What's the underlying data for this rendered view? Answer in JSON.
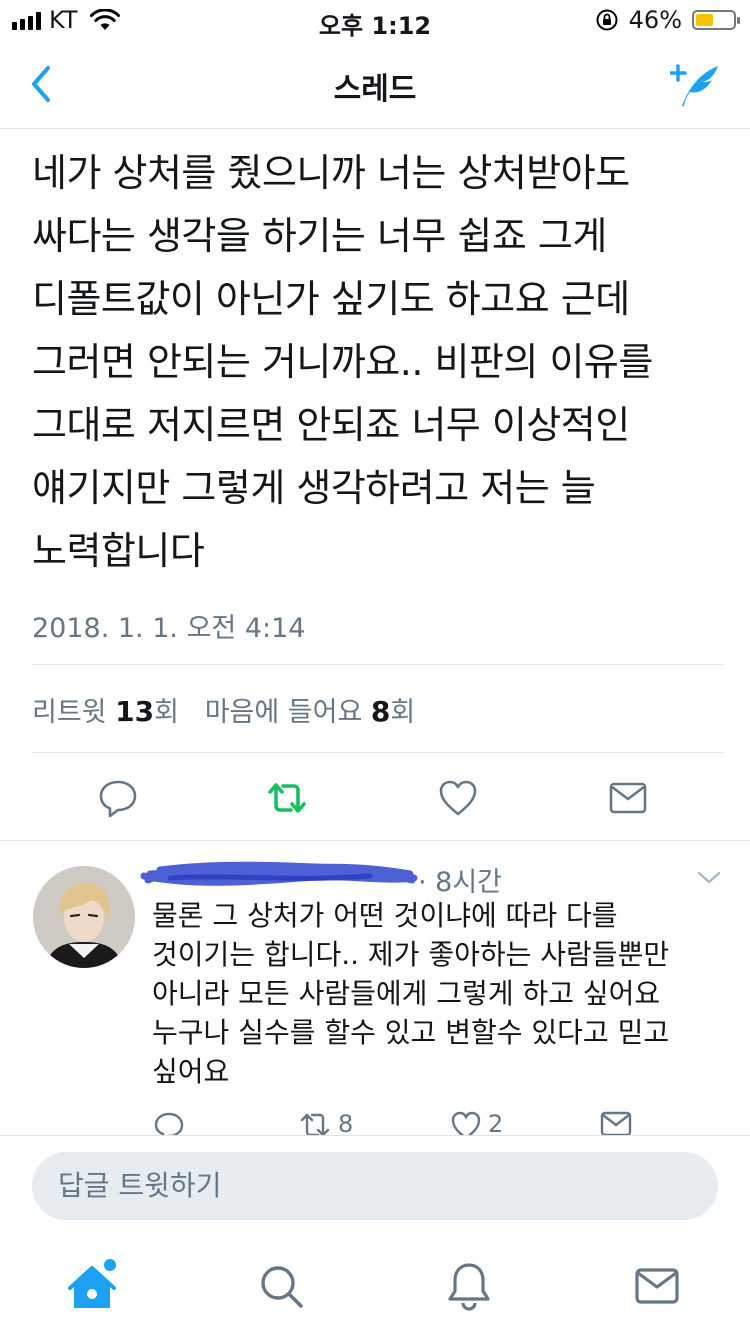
{
  "status_bar": {
    "carrier": "KT",
    "time": "오후 1:12",
    "battery_percent": "46%",
    "battery_level": 0.46,
    "battery_color": "#f5c400"
  },
  "nav": {
    "title": "스레드",
    "back_icon": "chevron-left-icon",
    "compose_icon": "compose-tweet-icon",
    "accent_color": "#1da1f2"
  },
  "tweet": {
    "lines": [
      "네가 상처를 줬으니까 너는 상처받아도",
      "싸다는 생각을 하기는 너무 쉽죠 그게",
      "디폴트값이 아닌가 싶기도 하고요 근데",
      "그러면 안되는 거니까요.. 비판의 이유를",
      "그대로 저지르면 안되죠 너무 이상적인",
      "얘기지만 그렇게 생각하려고 저는 늘",
      "노력합니다"
    ],
    "timestamp": "2018. 1. 1. 오전 4:14",
    "retweet_label": "리트윗",
    "retweet_count": "13",
    "retweet_unit": "회",
    "like_label": "마음에 들어요",
    "like_count": "8",
    "like_unit": "회",
    "retweet_active_color": "#17bf63"
  },
  "reply": {
    "time_ago": "· 8시간",
    "lines": [
      "물론 그 상처가 어떤 것이냐에 따라 다를",
      "것이기는 합니다.. 제가 좋아하는 사람들뿐만",
      "아니라 모든 사람들에게 그렇게 하고 싶어요",
      "누구나 실수를 할수 있고 변할수 있다고 믿고",
      "싶어요"
    ],
    "retweet_count": "8",
    "like_count": "2",
    "scribble_color": "#3a4fd0"
  },
  "reply_bar": {
    "placeholder": "답글 트윗하기"
  },
  "tab_bar": {
    "items": [
      "home-icon",
      "search-icon",
      "notifications-icon",
      "messages-icon"
    ]
  }
}
